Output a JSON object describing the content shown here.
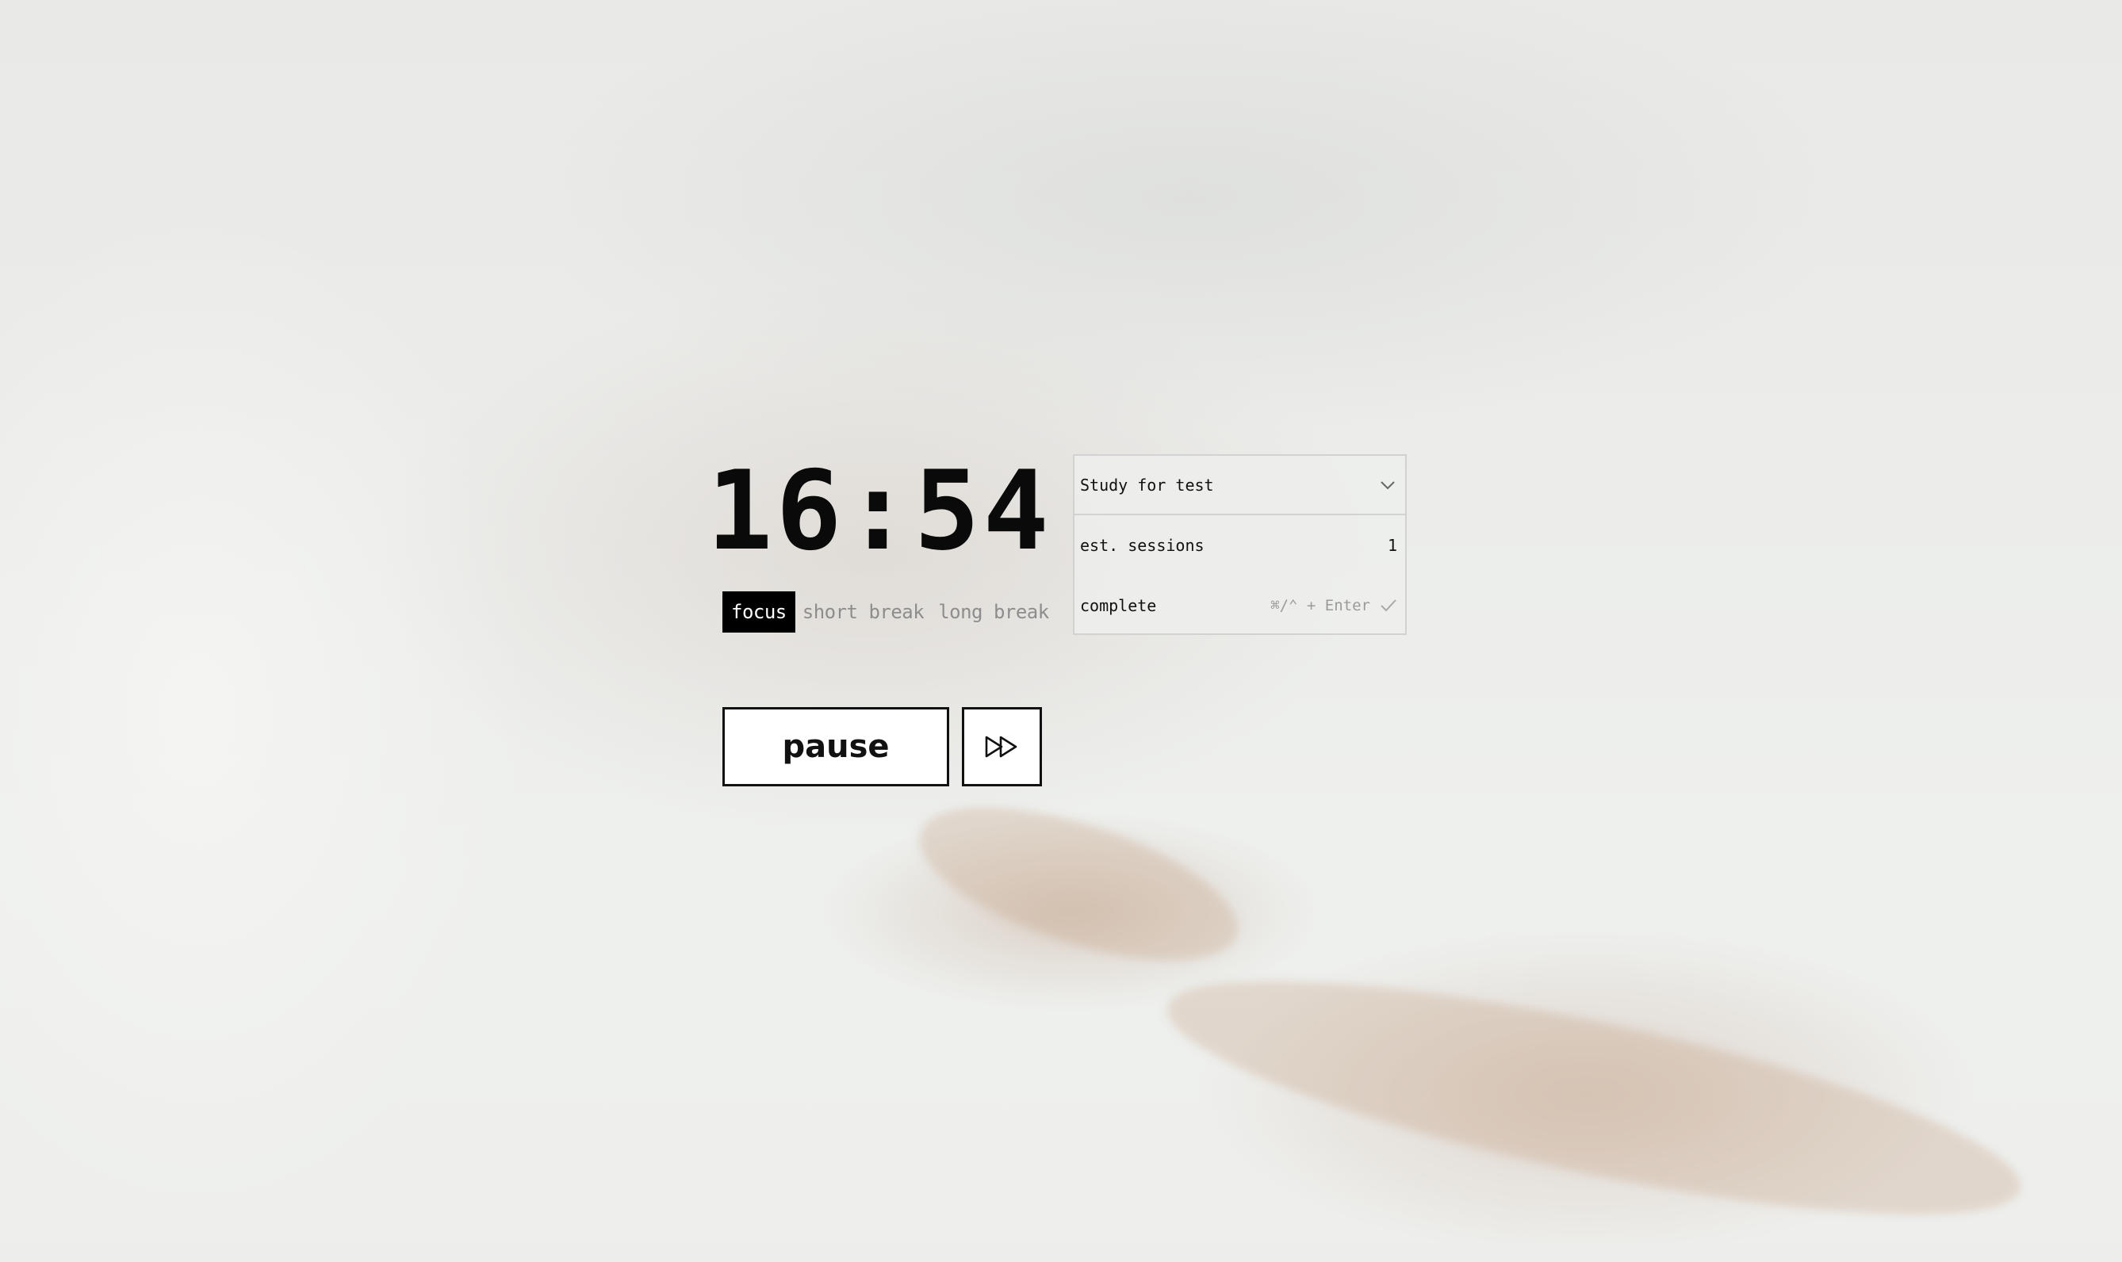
{
  "timer": {
    "time": "16:54"
  },
  "modes": [
    {
      "label": "focus",
      "active": true
    },
    {
      "label": "short break",
      "active": false
    },
    {
      "label": "long break",
      "active": false
    }
  ],
  "controls": {
    "pause_label": "pause",
    "skip_icon": "fast-forward-icon"
  },
  "task": {
    "selected": "Study for test",
    "sessions_label": "est. sessions",
    "sessions_value": "1",
    "complete_label": "complete",
    "complete_shortcut": "⌘/⌃ + Enter",
    "complete_icon": "checkmark-icon"
  }
}
